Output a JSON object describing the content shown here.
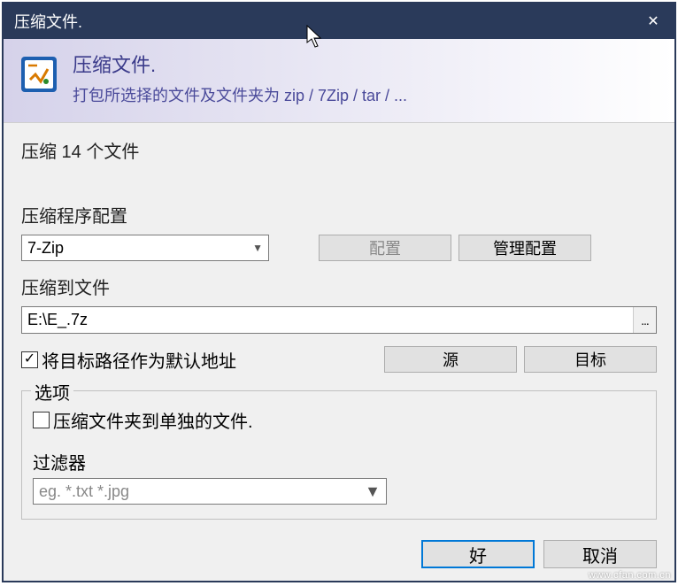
{
  "titlebar": {
    "title": "压缩文件."
  },
  "header": {
    "title": "压缩文件.",
    "subtitle": "打包所选择的文件及文件夹为 zip / 7Zip / tar / ..."
  },
  "body": {
    "info_line": "压缩 14 个文件",
    "profile_label": "压缩程序配置",
    "profile_value": "7-Zip",
    "configure_btn": "配置",
    "manage_btn": "管理配置",
    "dest_label": "压缩到文件",
    "dest_path": "E:\\E_.7z",
    "browse_glyph": "...",
    "default_path_checkbox": "将目标路径作为默认地址",
    "source_btn": "源",
    "target_btn": "目标",
    "options_legend": "选项",
    "per_folder_checkbox": "压缩文件夹到单独的文件.",
    "filter_label": "过滤器",
    "filter_placeholder": "eg. *.txt *.jpg"
  },
  "footer": {
    "ok": "好",
    "cancel": "取消"
  },
  "watermark": "www.cfan.com.cn"
}
